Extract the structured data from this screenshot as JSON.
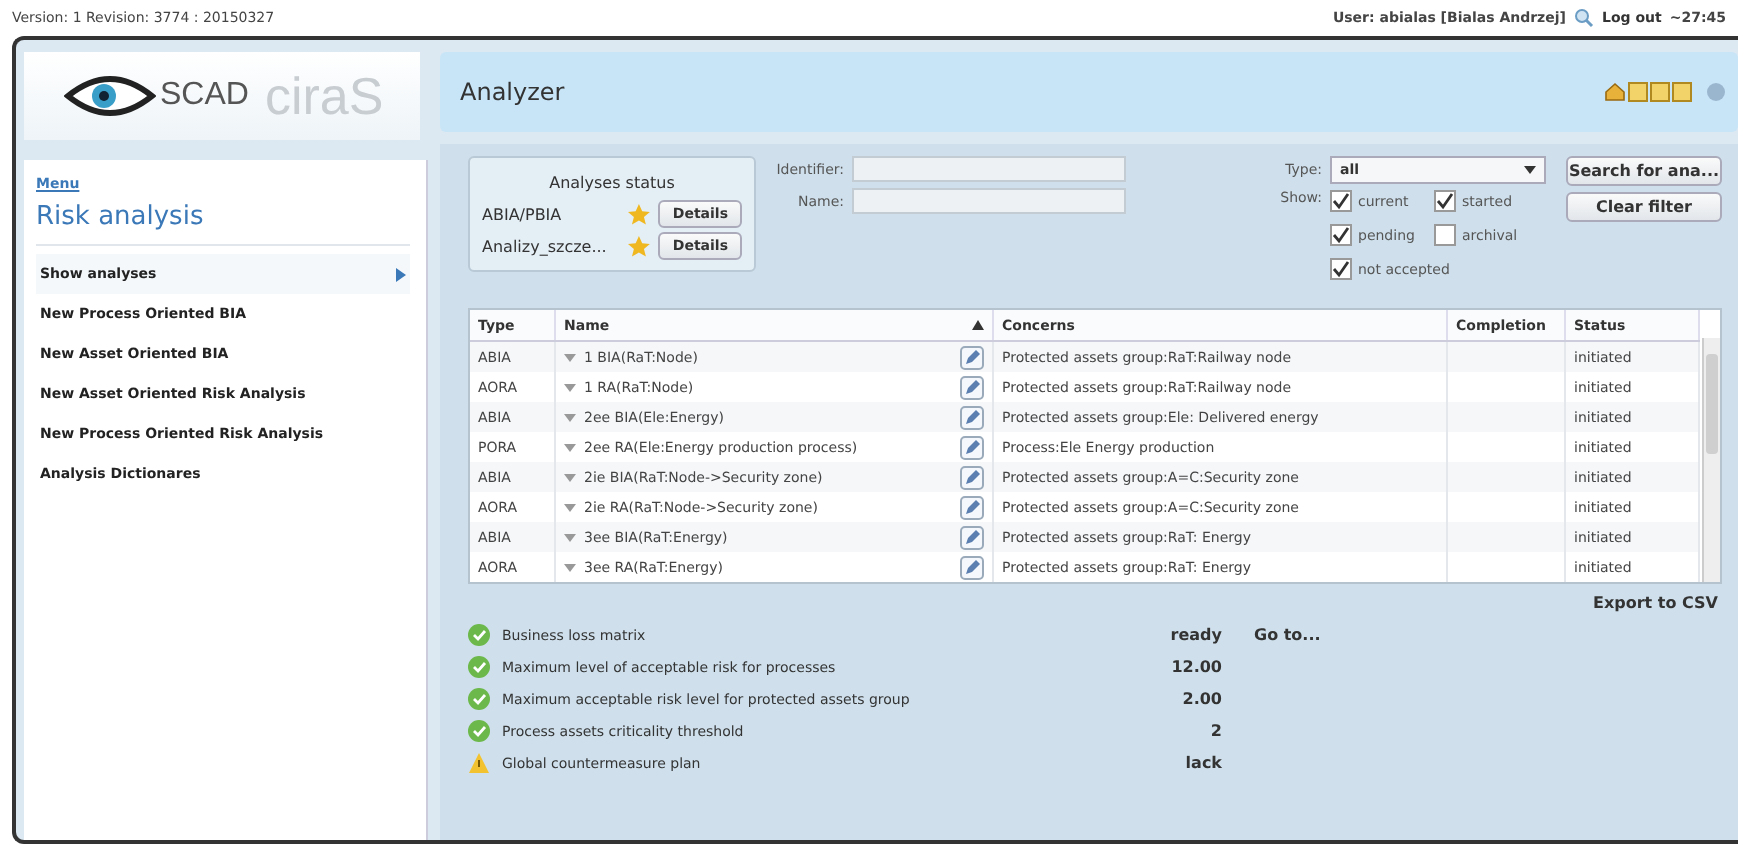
{
  "top_bar": {
    "version": "Version: 1 Revision: 3774 : 20150327",
    "user": "User: abialas [Bialas Andrzej]",
    "logout": "Log out",
    "timer": "~27:45"
  },
  "logo": {
    "left": "SCAD",
    "right": "ciraS"
  },
  "header": {
    "title": "Analyzer"
  },
  "sidebar": {
    "menu_link": "Menu",
    "title": "Risk analysis",
    "items": [
      {
        "label": "Show analyses",
        "selected": true
      },
      {
        "label": "New Process Oriented BIA",
        "selected": false
      },
      {
        "label": "New Asset Oriented BIA",
        "selected": false
      },
      {
        "label": "New Asset Oriented Risk Analysis",
        "selected": false
      },
      {
        "label": "New Process Oriented Risk Analysis",
        "selected": false
      },
      {
        "label": "Analysis Dictionares",
        "selected": false
      }
    ]
  },
  "analyses_status": {
    "title": "Analyses status",
    "rows": [
      {
        "name": "ABIA/PBIA",
        "button": "Details"
      },
      {
        "name": "Analizy_szcze...",
        "button": "Details"
      }
    ]
  },
  "filters": {
    "identifier_label": "Identifier:",
    "name_label": "Name:",
    "type_label": "Type:",
    "type_value": "all",
    "show_label": "Show:",
    "checkboxes": [
      {
        "label": "current",
        "checked": true
      },
      {
        "label": "started",
        "checked": true
      },
      {
        "label": "pending",
        "checked": true
      },
      {
        "label": "archival",
        "checked": false
      },
      {
        "label": "not accepted",
        "checked": true
      }
    ],
    "buttons": [
      "Search for ana...",
      "Clear filter"
    ]
  },
  "table": {
    "columns": [
      {
        "label": "Type",
        "sorted": false
      },
      {
        "label": "Name",
        "sorted": true
      },
      {
        "label": "Concerns",
        "sorted": false
      },
      {
        "label": "Completion",
        "sorted": false
      },
      {
        "label": "Status",
        "sorted": false
      }
    ],
    "rows": [
      {
        "type": "ABIA",
        "name": "1 BIA(RaT:Node)",
        "concerns": "Protected assets group:RaT:Railway node",
        "status": "initiated"
      },
      {
        "type": "AORA",
        "name": "1 RA(RaT:Node)",
        "concerns": "Protected assets group:RaT:Railway node",
        "status": "initiated"
      },
      {
        "type": "ABIA",
        "name": "2ee BIA(Ele:Energy)",
        "concerns": "Protected assets group:Ele: Delivered energy",
        "status": "initiated"
      },
      {
        "type": "PORA",
        "name": "2ee RA(Ele:Energy production process)",
        "concerns": "Process:Ele Energy production",
        "status": "initiated"
      },
      {
        "type": "ABIA",
        "name": "2ie BIA(RaT:Node->Security zone)",
        "concerns": "Protected assets group:A=C:Security zone",
        "status": "initiated"
      },
      {
        "type": "AORA",
        "name": "2ie RA(RaT:Node->Security zone)",
        "concerns": "Protected assets group:A=C:Security zone",
        "status": "initiated"
      },
      {
        "type": "ABIA",
        "name": "3ee BIA(RaT:Energy)",
        "concerns": "Protected assets group:RaT: Energy",
        "status": "initiated"
      },
      {
        "type": "AORA",
        "name": "3ee RA(RaT:Energy)",
        "concerns": "Protected assets group:RaT: Energy",
        "status": "initiated"
      }
    ]
  },
  "export": "Export to CSV",
  "checklist": [
    {
      "kind": "ok",
      "label": "Business loss matrix",
      "value": "ready",
      "link": "Go to..."
    },
    {
      "kind": "ok",
      "label": "Maximum level of acceptable risk for processes",
      "value": "12.00"
    },
    {
      "kind": "ok",
      "label": "Maximum acceptable risk level for protected assets group",
      "value": "2.00"
    },
    {
      "kind": "ok",
      "label": "Process assets criticality threshold",
      "value": "2"
    },
    {
      "kind": "warning",
      "label": "Global countermeasure plan",
      "value": "lack"
    }
  ]
}
